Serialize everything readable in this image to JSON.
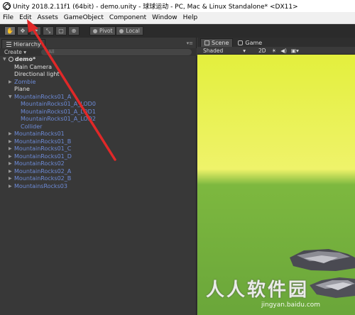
{
  "window": {
    "title": "Unity 2018.2.11f1 (64bit) - demo.unity - 球球运动 - PC, Mac & Linux Standalone* <DX11>"
  },
  "menu": {
    "items": [
      "File",
      "Edit",
      "Assets",
      "GameObject",
      "Component",
      "Window",
      "Help"
    ]
  },
  "toolbar": {
    "pivot_label": "Pivot",
    "local_label": "Local"
  },
  "hierarchy": {
    "tab_label": "Hierarchy",
    "create_label": "Create",
    "search_placeholder": "All",
    "scene_name": "demo*",
    "items": [
      {
        "label": "Main Camera",
        "indent": 1,
        "color": "white",
        "expander": ""
      },
      {
        "label": "Directional light",
        "indent": 1,
        "color": "white",
        "expander": ""
      },
      {
        "label": "Zombie",
        "indent": 1,
        "color": "blue",
        "expander": "collapsed"
      },
      {
        "label": "Plane",
        "indent": 1,
        "color": "white",
        "expander": ""
      },
      {
        "label": "MountainRocks01_A",
        "indent": 1,
        "color": "blue",
        "expander": "expanded"
      },
      {
        "label": "MountainRocks01_A_LOD0",
        "indent": 2,
        "color": "blue",
        "expander": ""
      },
      {
        "label": "MountainRocks01_A_LOD1",
        "indent": 2,
        "color": "blue",
        "expander": ""
      },
      {
        "label": "MountainRocks01_A_LOD2",
        "indent": 2,
        "color": "blue",
        "expander": ""
      },
      {
        "label": "Collider",
        "indent": 2,
        "color": "blue",
        "expander": ""
      },
      {
        "label": "MountainRocks01",
        "indent": 1,
        "color": "blue",
        "expander": "collapsed"
      },
      {
        "label": "MountainRocks01_B",
        "indent": 1,
        "color": "blue",
        "expander": "collapsed"
      },
      {
        "label": "MountainRocks01_C",
        "indent": 1,
        "color": "blue",
        "expander": "collapsed"
      },
      {
        "label": "MountainRocks01_D",
        "indent": 1,
        "color": "blue",
        "expander": "collapsed"
      },
      {
        "label": "MountainRocks02",
        "indent": 1,
        "color": "blue",
        "expander": "collapsed"
      },
      {
        "label": "MountainRocks02_A",
        "indent": 1,
        "color": "blue",
        "expander": "collapsed"
      },
      {
        "label": "MountainRocks02_B",
        "indent": 1,
        "color": "blue",
        "expander": "collapsed"
      },
      {
        "label": "MountainsRocks03",
        "indent": 1,
        "color": "blue",
        "expander": "collapsed"
      }
    ]
  },
  "scene": {
    "tab_scene": "Scene",
    "tab_game": "Game",
    "shading_mode": "Shaded",
    "mode_2d": "2D"
  },
  "watermark": {
    "text": "人人软件园",
    "url": "jingyan.baidu.com"
  },
  "colors": {
    "annotation_arrow": "#e02828",
    "hierarchy_prefab_text": "#6d8bd8"
  }
}
